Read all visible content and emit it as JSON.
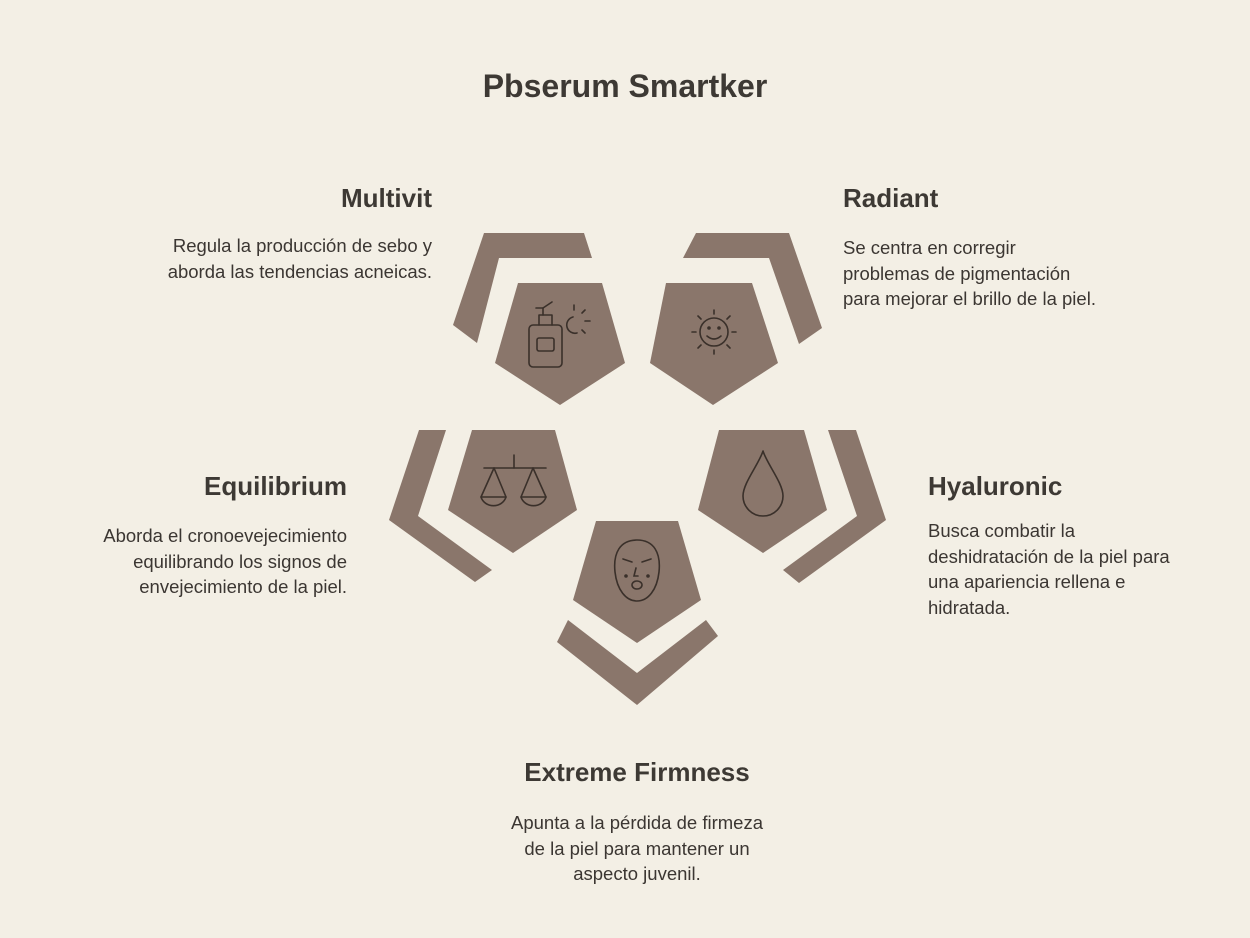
{
  "title": "Pbserum Smartker",
  "colors": {
    "background": "#f3efe5",
    "shape": "#8a766b",
    "icon_stroke": "#3a302a",
    "text": "#3b3632"
  },
  "items": [
    {
      "name": "Multivit",
      "icon": "serum-bottle-sun-icon",
      "desc": [
        "Regula la producción de sebo y",
        "aborda las tendencias acneicas."
      ]
    },
    {
      "name": "Radiant",
      "icon": "smiling-sun-icon",
      "desc": [
        "Se centra en corregir",
        "problemas de pigmentación",
        "para mejorar el brillo de la piel."
      ]
    },
    {
      "name": "Equilibrium",
      "icon": "balance-scale-icon",
      "desc": [
        "Aborda el cronoevejecimiento",
        "equilibrando los signos de",
        "envejecimiento de la piel."
      ]
    },
    {
      "name": "Hyaluronic",
      "icon": "water-drop-icon",
      "desc": [
        "Busca combatir la",
        "deshidratación de la piel para",
        "una apariencia rellena e",
        "hidratada."
      ]
    },
    {
      "name": "Extreme Firmness",
      "icon": "face-mask-icon",
      "desc": [
        "Apunta a la pérdida de firmeza",
        "de la piel para mantener un",
        "aspecto juvenil."
      ]
    }
  ]
}
